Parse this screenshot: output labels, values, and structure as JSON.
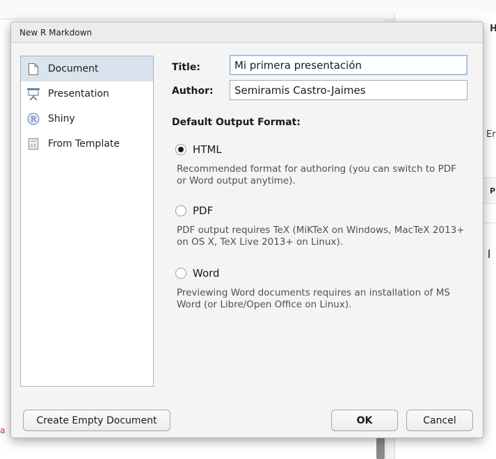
{
  "dialog": {
    "title": "New R Markdown"
  },
  "sidebar": {
    "items": [
      {
        "label": "Document",
        "icon": "document-icon",
        "selected": true
      },
      {
        "label": "Presentation",
        "icon": "presentation-icon",
        "selected": false
      },
      {
        "label": "Shiny",
        "icon": "shiny-r-icon",
        "selected": false
      },
      {
        "label": "From Template",
        "icon": "template-icon",
        "selected": false
      }
    ]
  },
  "form": {
    "title_label": "Title:",
    "title_value": "Mi primera presentación",
    "author_label": "Author:",
    "author_value": "Semiramis Castro-Jaimes",
    "output_format_label": "Default Output Format:"
  },
  "formats": [
    {
      "label": "HTML",
      "checked": true,
      "description": "Recommended format for authoring (you can switch to PDF or Word output anytime)."
    },
    {
      "label": "PDF",
      "checked": false,
      "description": "PDF output requires TeX (MiKTeX on Windows, MacTeX 2013+ on OS X, TeX Live 2013+ on Linux)."
    },
    {
      "label": "Word",
      "checked": false,
      "description": "Previewing Word documents requires an installation of MS Word (or Libre/Open Office on Linux)."
    }
  ],
  "buttons": {
    "create_empty": "Create Empty Document",
    "ok": "OK",
    "cancel": "Cancel"
  },
  "colors": {
    "selection": "#d9e4ef",
    "accent": "#8fb0d6"
  }
}
